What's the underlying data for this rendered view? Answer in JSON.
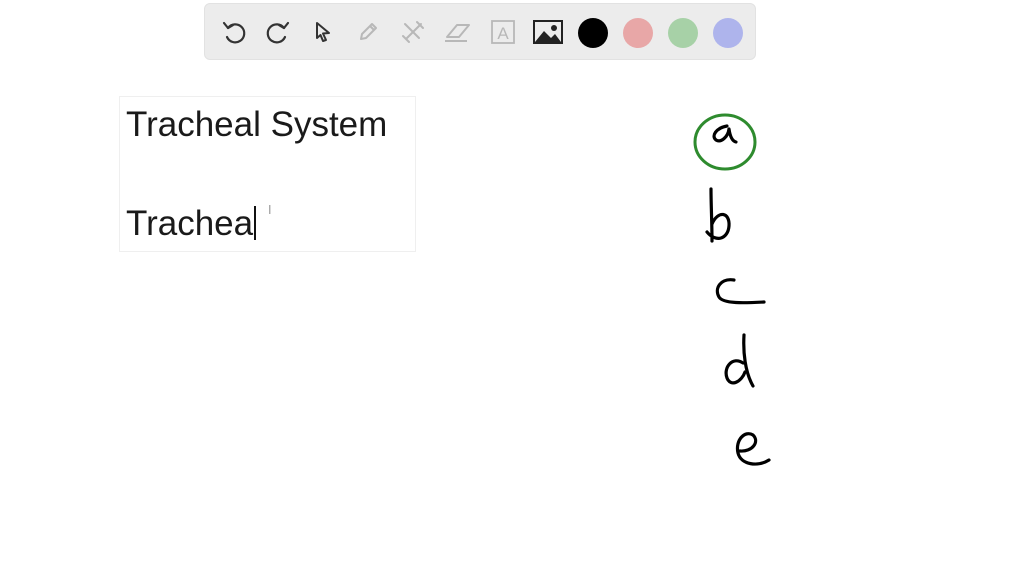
{
  "toolbar": {
    "tools": [
      {
        "name": "undo-icon"
      },
      {
        "name": "redo-icon"
      },
      {
        "name": "pointer-icon"
      },
      {
        "name": "pen-icon"
      },
      {
        "name": "tools-icon"
      },
      {
        "name": "eraser-icon"
      },
      {
        "name": "text-icon",
        "glyph": "A"
      },
      {
        "name": "image-icon"
      }
    ],
    "colors": [
      "#000000",
      "#e8a7a7",
      "#a7d1a7",
      "#aeb4ec"
    ]
  },
  "textbox": {
    "line1": "Tracheal System",
    "line2": "Trachea"
  },
  "handwriting": {
    "labels": [
      "a",
      "b",
      "c",
      "d",
      "e"
    ],
    "selected_label": "a",
    "ink_color": "#000000",
    "highlight_color": "#2e8b2e"
  }
}
